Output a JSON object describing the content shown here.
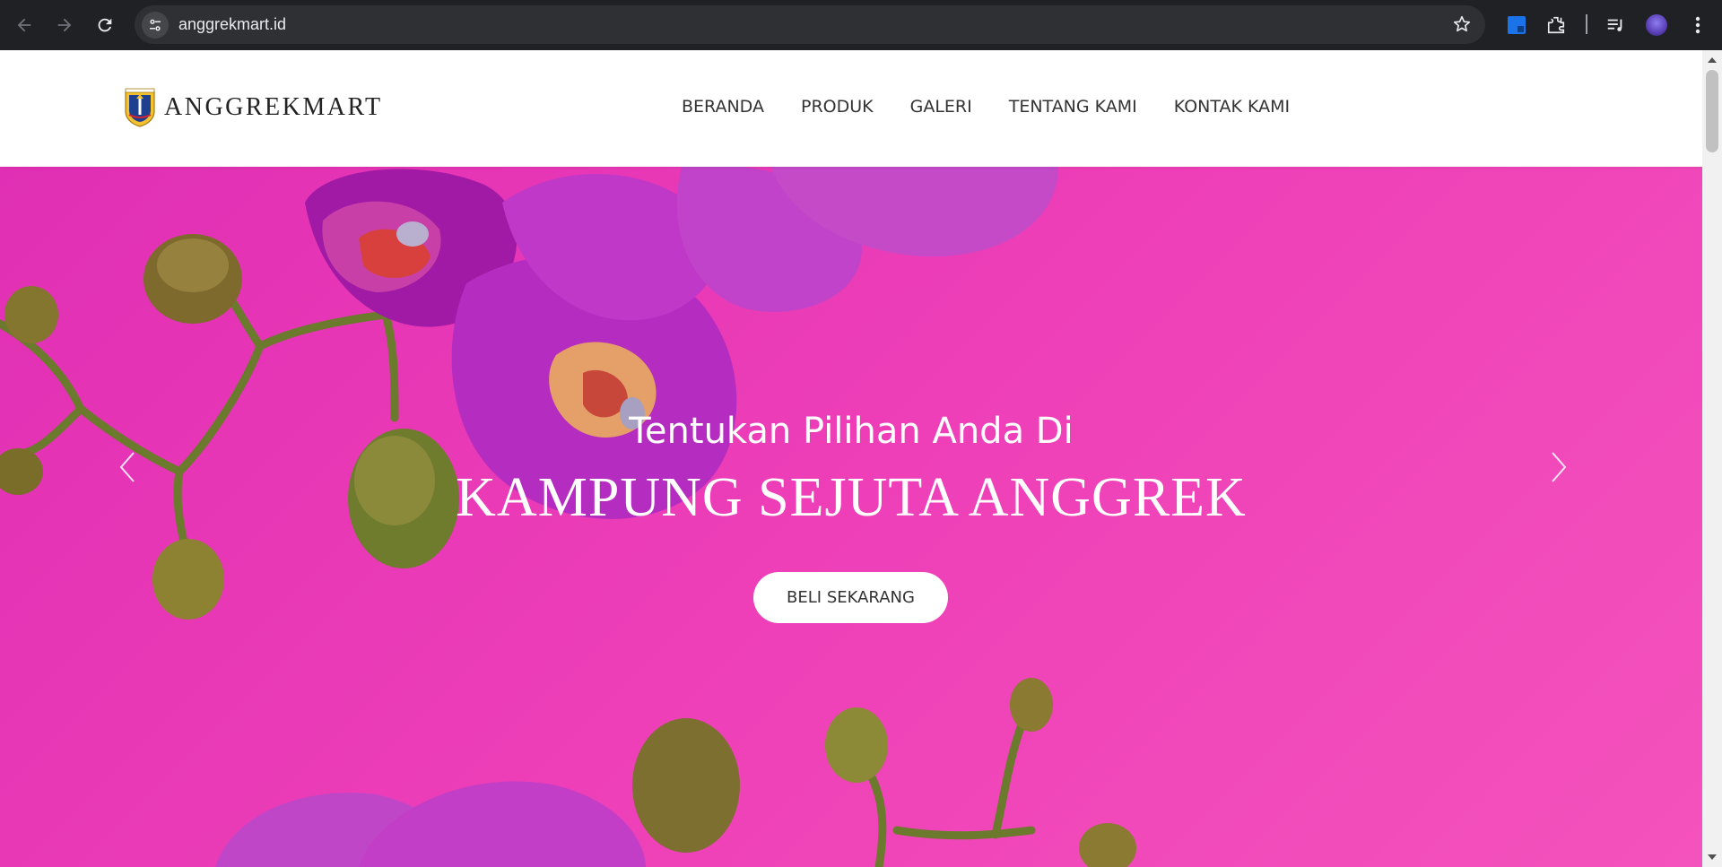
{
  "browser": {
    "url": "anggrekmart.id",
    "colors": {
      "chrome_bg": "#202124",
      "omnibox_bg": "#2f3033",
      "url_text": "#e8eaed"
    },
    "icons": {
      "back": "arrow-left-icon",
      "forward": "arrow-right-icon",
      "reload": "reload-icon",
      "site_info": "tune-icon",
      "bookmark": "star-icon",
      "extension_blue": "extension-app-icon",
      "extensions": "puzzle-icon",
      "media": "media-queue-icon",
      "profile": "avatar",
      "menu": "kebab-menu-icon"
    }
  },
  "site": {
    "brand": "ANGGREKMART",
    "nav": [
      {
        "label": "BERANDA"
      },
      {
        "label": "PRODUK"
      },
      {
        "label": "GALERI"
      },
      {
        "label": "TENTANG KAMI"
      },
      {
        "label": "KONTAK KAMI"
      }
    ]
  },
  "hero": {
    "subtitle": "Tentukan Pilihan Anda Di",
    "title": "KAMPUNG SEJUTA ANGGREK",
    "cta": "BELI SEKARANG",
    "background_color": "#ee3fb8",
    "icons": {
      "prev": "chevron-left-icon",
      "next": "chevron-right-icon"
    }
  }
}
